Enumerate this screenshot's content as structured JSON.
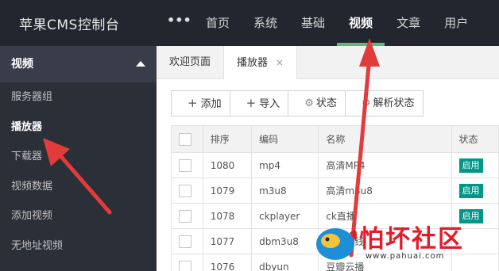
{
  "app": {
    "title": "苹果CMS控制台"
  },
  "topnav": {
    "more": "•••",
    "items": [
      {
        "label": "首页"
      },
      {
        "label": "系统"
      },
      {
        "label": "基础"
      },
      {
        "label": "视频",
        "active": true
      },
      {
        "label": "文章"
      },
      {
        "label": "用户"
      }
    ]
  },
  "sidebar": {
    "section_title": "视频",
    "items": [
      {
        "label": "服务器组"
      },
      {
        "label": "播放器",
        "active": true
      },
      {
        "label": "下载器"
      },
      {
        "label": "视频数据"
      },
      {
        "label": "添加视频"
      },
      {
        "label": "无地址视频"
      }
    ]
  },
  "tabs": [
    {
      "label": "欢迎页面"
    },
    {
      "label": "播放器",
      "close": "×",
      "active": true
    }
  ],
  "toolbar": {
    "add": "添加",
    "import": "导入",
    "status": "状态",
    "parse_status": "解析状态"
  },
  "table": {
    "headers": [
      "排序",
      "编码",
      "名称",
      "状态"
    ],
    "rows": [
      {
        "order": "1080",
        "code": "mp4",
        "name": "高清MP4",
        "status": "启用"
      },
      {
        "order": "1079",
        "code": "m3u8",
        "name": "高清m3u8",
        "status": "启用"
      },
      {
        "order": "1078",
        "code": "ckplayer",
        "name": "ck直播",
        "status": "启用"
      },
      {
        "order": "1077",
        "code": "dbm3u8",
        "name": "豆瓣在线",
        "status": ""
      },
      {
        "order": "1076",
        "code": "dbyun",
        "name": "豆瓣云播",
        "status": ""
      }
    ]
  },
  "watermark": {
    "text": "怕坏社区",
    "url": "www.pahuai.com"
  },
  "colors": {
    "accent": "#5fb878",
    "badge": "#009688",
    "arrow": "#e23b3b"
  }
}
